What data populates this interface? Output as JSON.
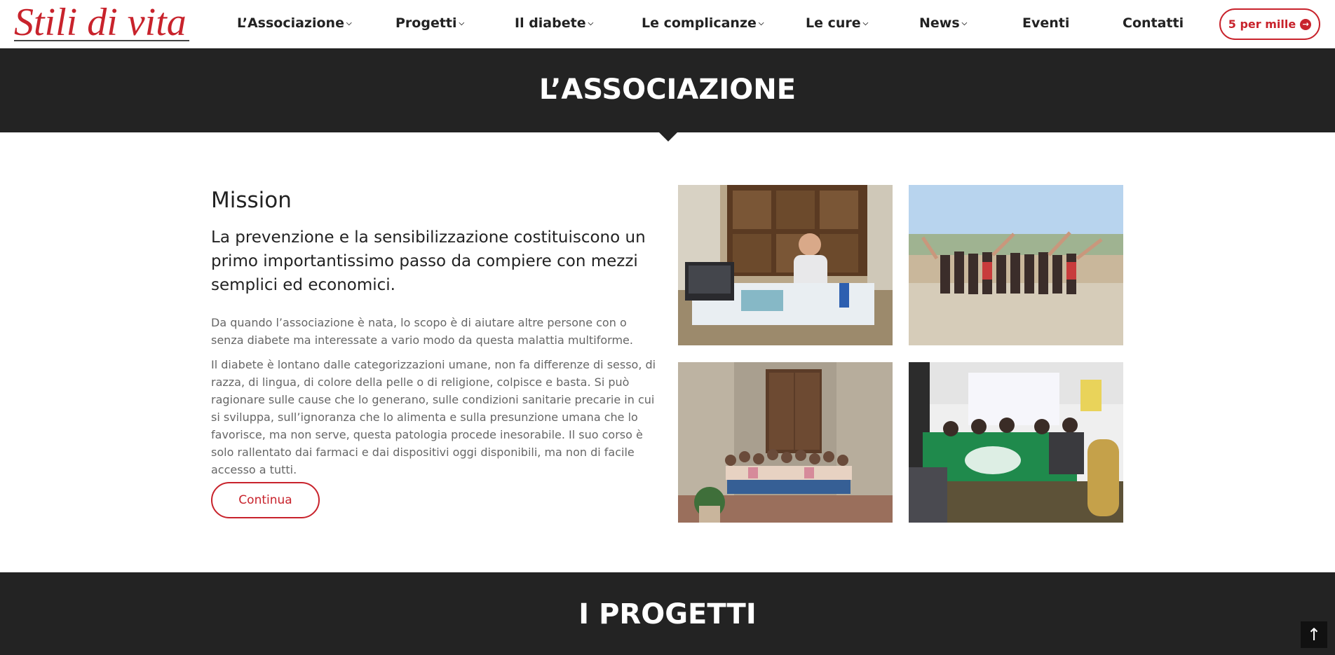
{
  "header": {
    "logo_text": "Stili di vita",
    "nav": [
      {
        "label": "L’Associazione",
        "has_dropdown": true
      },
      {
        "label": "Progetti",
        "has_dropdown": true
      },
      {
        "label": "Il diabete",
        "has_dropdown": true
      },
      {
        "label": "Le complicanze",
        "has_dropdown": true
      },
      {
        "label": "Le cure",
        "has_dropdown": true
      },
      {
        "label": "News",
        "has_dropdown": true
      },
      {
        "label": "Eventi",
        "has_dropdown": false
      },
      {
        "label": "Contatti",
        "has_dropdown": false
      }
    ],
    "cta_label": "5 per mille",
    "cta_icon": "arrow-circle-right-icon"
  },
  "hero": {
    "title": "L’ASSOCIAZIONE"
  },
  "mission": {
    "title": "Mission",
    "lead": "La prevenzione e la sensibilizzazione costituiscono un primo importantissimo passo da compiere con mezzi semplici ed economici.",
    "paragraph_1": "Da quando l’associazione è nata, lo scopo è di aiutare altre persone con o senza diabete ma interessate a vario modo da questa malattia multiforme.",
    "paragraph_2": "Il diabete è lontano dalle categorizzazioni umane, non fa differenze di sesso, di razza, di lingua, di colore della pelle o di religione, colpisce e basta. Si può ragionare sulle cause che lo generano, sulle condizioni sanitarie precarie in cui si sviluppa, sull’ignoranza che lo alimenta e sulla presunzione umana che lo favorisce, ma non serve, questa patologia procede inesorabile. Il suo corso è solo rallentato dai farmaci e dai dispositivi oggi disponibili, ma non di facile accesso a tutti.",
    "button_label": "Continua"
  },
  "section2": {
    "title": "I PROGETTI"
  },
  "colors": {
    "brand_red": "#c8232c",
    "dark_band": "#232323"
  }
}
